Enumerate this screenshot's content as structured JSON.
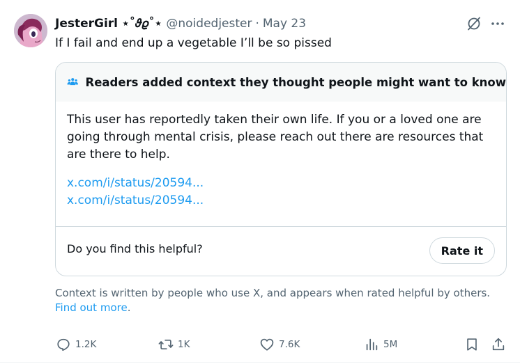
{
  "tweet": {
    "display_name": "JesterGirl ⋆˚𝜗𝜚˚⋆",
    "handle": "@noidedjester",
    "separator": "·",
    "date": "May 23",
    "text": "If I fail and end up a vegetable I’ll be so pissed",
    "icons": {
      "avatar": "pony-avatar",
      "grok": "grok-icon",
      "more": "more-icon"
    }
  },
  "note": {
    "title": "Readers added context they thought people might want to know",
    "icon": "people-icon",
    "body": "This user has reportedly taken their own life. If you or a loved one are going through mental crisis, please reach out there are resources that are there to help.",
    "links": [
      "x.com/i/status/20594...",
      "x.com/i/status/20594..."
    ],
    "helpful_question": "Do you find this helpful?",
    "rate_label": "Rate it"
  },
  "context_info": {
    "text": "Context is written by people who use X, and appears when rated helpful by others.",
    "link": "Find out more",
    "period": "."
  },
  "actions": {
    "replies": "1.2K",
    "reposts": "1K",
    "likes": "7.6K",
    "views": "5M"
  },
  "colors": {
    "link": "#1d9bf0",
    "secondary_text": "#536471",
    "border": "#cfd9de",
    "note_header_bg": "#f7f9f9"
  }
}
